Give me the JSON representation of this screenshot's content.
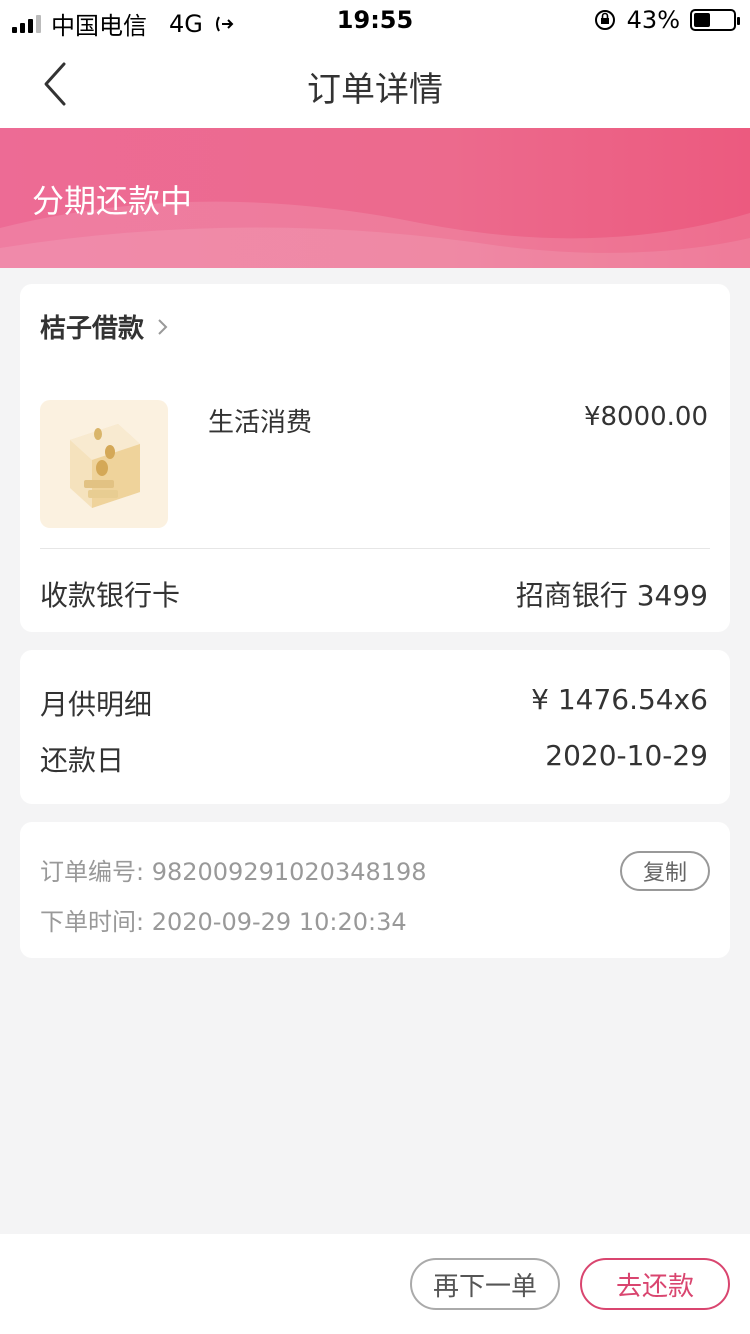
{
  "status_bar": {
    "carrier": "中国电信",
    "network": "4G",
    "time": "19:55",
    "battery": "43%",
    "battery_level": 0.43
  },
  "nav": {
    "title": "订单详情"
  },
  "banner": {
    "status": "分期还款中"
  },
  "order_card": {
    "lender": "桔子借款",
    "product_name": "生活消费",
    "amount": "¥8000.00",
    "bank_label": "收款银行卡",
    "bank_value": "招商银行 3499"
  },
  "repayment_card": {
    "monthly_label": "月供明细",
    "monthly_value": "¥ 1476.54x6",
    "due_label": "还款日",
    "due_value": "2020-10-29"
  },
  "info_card": {
    "order_no": "订单编号: 982009291020348198",
    "order_time": "下单时间: 2020-09-29 10:20:34",
    "copy_label": "复制"
  },
  "footer": {
    "reorder_label": "再下一单",
    "repay_label": "去还款"
  },
  "colors": {
    "banner": "#ec6a8d",
    "accent": "#d9456f"
  }
}
